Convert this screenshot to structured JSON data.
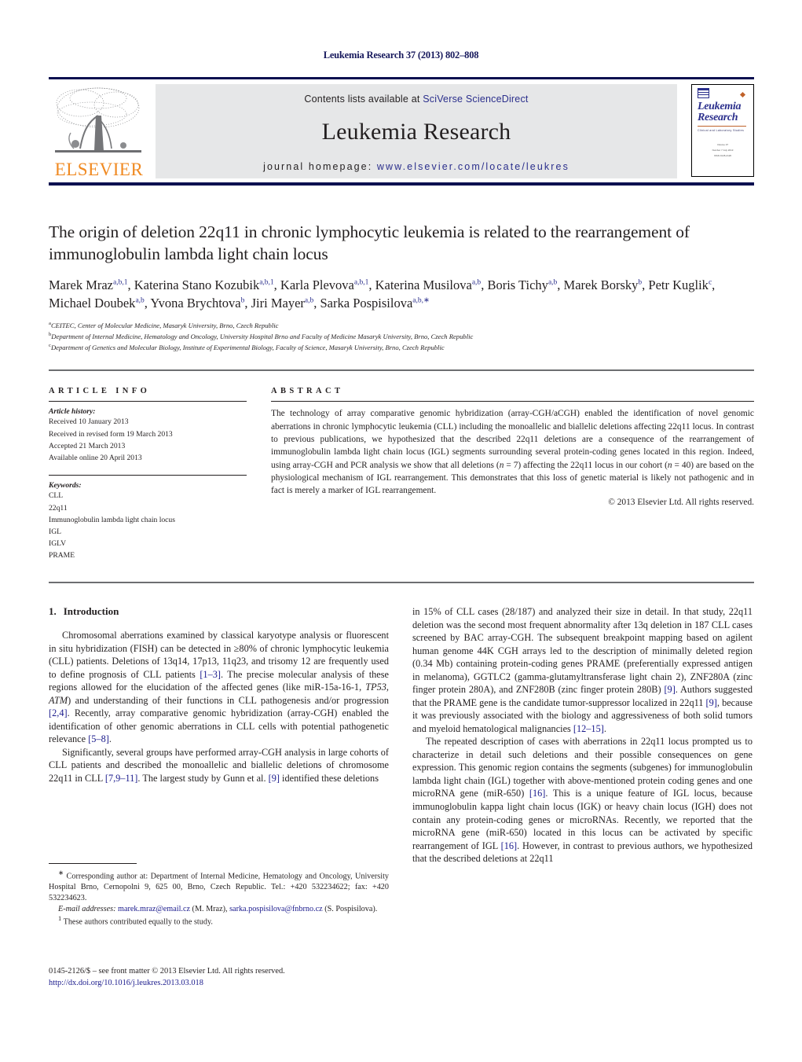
{
  "running_head": "Leukemia Research 37 (2013) 802–808",
  "masthead": {
    "contents_prefix": "Contents lists available at ",
    "contents_link": "SciVerse ScienceDirect",
    "journal_title": "Leukemia Research",
    "homepage_prefix": "journal homepage: ",
    "homepage_url": "www.elsevier.com/locate/leukres",
    "publisher_wordmark": "ELSEVIER",
    "cover": {
      "line1": "Leukemia",
      "line2": "Research",
      "subtitle": "Clinical and Laboratory Studies",
      "meta1": "Volume 37",
      "meta2": "Number 7   July 2013",
      "meta3": "ISSN 0145-2126"
    }
  },
  "article": {
    "title": "The origin of deletion 22q11 in chronic lymphocytic leukemia is related to the rearrangement of immunoglobulin lambda light chain locus",
    "authors_html": "Marek Mraz<sup>a,b,1</sup>, Katerina Stano Kozubik<sup>a,b,1</sup>, Karla Plevova<sup>a,b,1</sup>, Katerina Musilova<sup>a,b</sup>, Boris Tichy<sup>a,b</sup>, Marek Borsky<sup>b</sup>, Petr Kuglik<sup>c</sup>, Michael Doubek<sup>a,b</sup>, Yvona Brychtova<sup>b</sup>, Jiri Mayer<sup>a,b</sup>, Sarka Pospisilova<sup>a,b,∗</sup>",
    "affiliations": [
      {
        "marker": "a",
        "text": "CEITEC, Center of Molecular Medicine, Masaryk University, Brno, Czech Republic"
      },
      {
        "marker": "b",
        "text": "Department of Internal Medicine, Hematology and Oncology, University Hospital Brno and Faculty of Medicine Masaryk University, Brno, Czech Republic"
      },
      {
        "marker": "c",
        "text": "Department of Genetics and Molecular Biology, Institute of Experimental Biology, Faculty of Science, Masaryk University, Brno, Czech Republic"
      }
    ]
  },
  "article_info": {
    "heading": "ARTICLE INFO",
    "history_label": "Article history:",
    "history": [
      "Received 10 January 2013",
      "Received in revised form 19 March 2013",
      "Accepted 21 March 2013",
      "Available online 20 April 2013"
    ],
    "keywords_label": "Keywords:",
    "keywords": [
      "CLL",
      "22q11",
      "Immunoglobulin lambda light chain locus",
      "IGL",
      "IGLV",
      "PRAME"
    ]
  },
  "abstract": {
    "heading": "ABSTRACT",
    "text_html": "The technology of array comparative genomic hybridization (array-CGH/aCGH) enabled the identification of novel genomic aberrations in chronic lymphocytic leukemia (CLL) including the monoallelic and biallelic deletions affecting 22q11 locus. In contrast to previous publications, we hypothesized that the described 22q11 deletions are a consequence of the rearrangement of immunoglobulin lambda light chain locus (IGL) segments surrounding several protein-coding genes located in this region. Indeed, using array-CGH and PCR analysis we show that all deletions (<span class=\"it\">n</span> = 7) affecting the 22q11 locus in our cohort (<span class=\"it\">n</span> = 40) are based on the physiological mechanism of IGL rearrangement. This demonstrates that this loss of genetic material is likely not pathogenic and in fact is merely a marker of IGL rearrangement.",
    "copyright": "© 2013 Elsevier Ltd. All rights reserved."
  },
  "body": {
    "section_number": "1.",
    "section_title": "Introduction",
    "left_paragraphs_html": [
      "Chromosomal aberrations examined by classical karyotype analysis or fluorescent in situ hybridization (FISH) can be detected in ≥80% of chronic lymphocytic leukemia (CLL) patients. Deletions of 13q14, 17p13, 11q23, and trisomy 12 are frequently used to define prognosis of CLL patients <span class=\"ref\">[1–3]</span>. The precise molecular analysis of these regions allowed for the elucidation of the affected genes (like miR-15a-16-1, <span class=\"it\">TP53</span>, <span class=\"it\">ATM</span>) and understanding of their functions in CLL pathogenesis and/or progression <span class=\"ref\">[2,4]</span>. Recently, array comparative genomic hybridization (array-CGH) enabled the identification of other genomic aberrations in CLL cells with potential pathogenetic relevance <span class=\"ref\">[5–8]</span>.",
      "Significantly, several groups have performed array-CGH analysis in large cohorts of CLL patients and described the monoallelic and biallelic deletions of chromosome 22q11 in CLL <span class=\"ref\">[7,9–11]</span>. The largest study by Gunn et al. <span class=\"ref\">[9]</span> identified these deletions"
    ],
    "right_paragraphs_html": [
      "in 15% of CLL cases (28/187) and analyzed their size in detail. In that study, 22q11 deletion was the second most frequent abnormality after 13q deletion in 187 CLL cases screened by BAC array-CGH. The subsequent breakpoint mapping based on agilent human genome 44K CGH arrays led to the description of minimally deleted region (0.34 Mb) containing protein-coding genes PRAME (preferentially expressed antigen in melanoma), GGTLC2 (gamma-glutamyltransferase light chain 2), ZNF280A (zinc finger protein 280A), and ZNF280B (zinc finger protein 280B) <span class=\"ref\">[9]</span>. Authors suggested that the PRAME gene is the candidate tumor-suppressor localized in 22q11 <span class=\"ref\">[9]</span>, because it was previously associated with the biology and aggressiveness of both solid tumors and myeloid hematological malignancies <span class=\"ref\">[12–15]</span>.",
      "The repeated description of cases with aberrations in 22q11 locus prompted us to characterize in detail such deletions and their possible consequences on gene expression. This genomic region contains the segments (subgenes) for immunoglobulin lambda light chain (IGL) together with above-mentioned protein coding genes and one microRNA gene (miR-650) <span class=\"ref\">[16]</span>. This is a unique feature of IGL locus, because immunoglobulin kappa light chain locus (IGK) or heavy chain locus (IGH) does not contain any protein-coding genes or microRNAs. Recently, we reported that the microRNA gene (miR-650) located in this locus can be activated by specific rearrangement of IGL <span class=\"ref\">[16]</span>. However, in contrast to previous authors, we hypothesized that the described deletions at 22q11"
    ]
  },
  "footnotes": {
    "corresponding_html": "<sup>∗</sup> Corresponding author at: Department of Internal Medicine, Hematology and Oncology, University Hospital Brno, Cernopolni 9, 625 00, Brno, Czech Republic. Tel.: +420 532234622; fax: +420 532234623.",
    "email_html": "<span class=\"em\">E-mail addresses:</span> <span class=\"mail\">marek.mraz@email.cz</span> (M. Mraz), <span class=\"mail\">sarka.pospisilova@fnbrno.cz</span> (S. Pospisilova).",
    "equal_html": "<sup>1</sup> These authors contributed equally to the study."
  },
  "imprint": {
    "line1": "0145-2126/$ – see front matter © 2013 Elsevier Ltd. All rights reserved.",
    "doi": "http://dx.doi.org/10.1016/j.leukres.2013.03.018"
  },
  "colors": {
    "navy_rule": "#0b1050",
    "link_blue": "#2b2f8c",
    "reference_blue": "#1a1a8c",
    "elsevier_orange": "#f08a22",
    "panel_grey": "#e6e7e8",
    "cover_rule_orange": "#c0622a"
  }
}
